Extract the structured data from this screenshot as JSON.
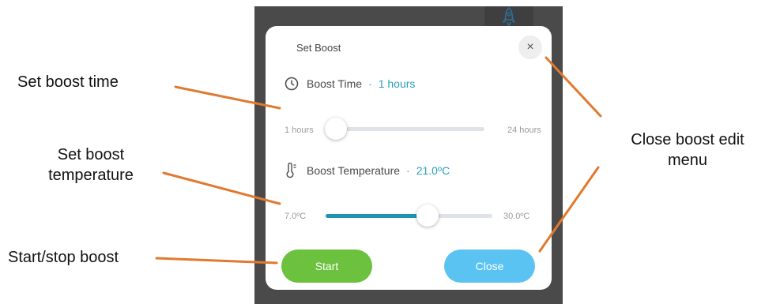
{
  "dialog": {
    "title": "Set Boost",
    "close_icon_glyph": "×",
    "boost_time": {
      "label": "Boost Time",
      "value_text": "1 hours",
      "min_label": "1 hours",
      "max_label": "24 hours",
      "level_fraction": 0.0,
      "icon": "clock-icon"
    },
    "boost_temperature": {
      "label": "Boost Temperature",
      "value_text": "21.0ºC",
      "min_label": "7.0ºC",
      "max_label": "30.0ºC",
      "level_fraction": 0.61,
      "icon": "thermometer-icon"
    },
    "start_label": "Start",
    "close_label": "Close",
    "separator": "·"
  },
  "callouts": {
    "set_boost_time": "Set boost time",
    "set_boost_temperature_line1": "Set boost",
    "set_boost_temperature_line2": "temperature",
    "start_stop_boost": "Start/stop boost",
    "close_boost_edit_line1": "Close boost edit",
    "close_boost_edit_line2": "menu"
  },
  "colors": {
    "accent": "#2a9fbd",
    "start_button": "#6cc13e",
    "close_button": "#5bc3f2",
    "callout_line": "#e07a2f",
    "backdrop": "#4a4a4a"
  }
}
